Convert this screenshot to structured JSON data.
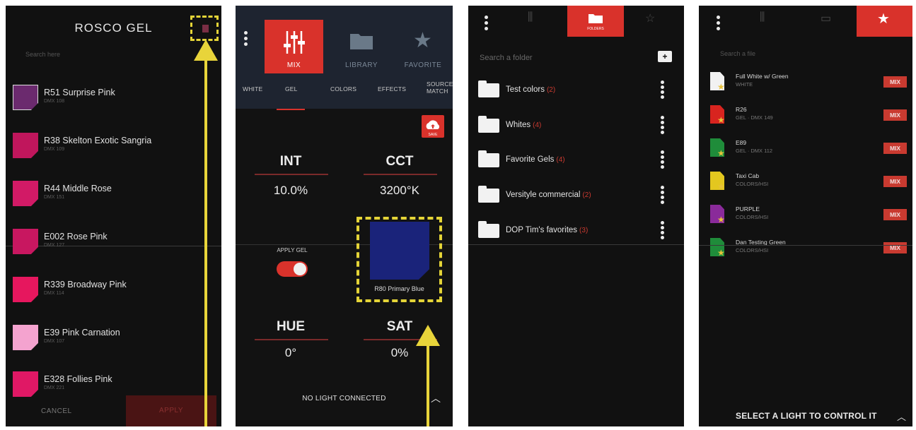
{
  "panel1": {
    "title": "ROSCO GEL",
    "search_placeholder": "Search here",
    "gels": [
      {
        "name": "R51 Surprise Pink",
        "code": "DMX 108",
        "color": "#6b2a6e"
      },
      {
        "name": "R38 Skelton Exotic Sangria",
        "code": "DMX 109",
        "color": "#c0165c"
      },
      {
        "name": "R44 Middle Rose",
        "code": "DMX 151",
        "color": "#d21a66"
      },
      {
        "name": "E002 Rose Pink",
        "code": "DMX 127",
        "color": "#c81760"
      },
      {
        "name": "R339 Broadway Pink",
        "code": "DMX 114",
        "color": "#e6175e"
      },
      {
        "name": "E39 Pink Carnation",
        "code": "DMX 107",
        "color": "#f4a3cf"
      },
      {
        "name": "E328 Follies Pink",
        "code": "DMX 221",
        "color": "#e01865"
      }
    ],
    "cancel_label": "CANCEL",
    "apply_label": "APPLY"
  },
  "panel2": {
    "tabs": [
      {
        "label": "MIX"
      },
      {
        "label": "LIBRARY"
      },
      {
        "label": "FAVORITE"
      }
    ],
    "subtabs": [
      "WHITE",
      "GEL",
      "COLORS",
      "EFFECTS",
      "SOURCE MATCH"
    ],
    "cloud_label": "SAVE",
    "int_label": "INT",
    "int_value": "10.0%",
    "cct_label": "CCT",
    "cct_value": "3200°K",
    "apply_gel_label": "APPLY GEL",
    "swatch_name": "R80 Primary Blue",
    "swatch_color": "#1a237a",
    "hue_label": "HUE",
    "hue_value": "0°",
    "sat_label": "SAT",
    "sat_value": "0%",
    "status": "NO LIGHT CONNECTED"
  },
  "panel3": {
    "active_tab": "FOLDERS",
    "search_placeholder": "Search a folder",
    "folders": [
      {
        "name": "Test colors",
        "count": "(2)"
      },
      {
        "name": "Whites",
        "count": "(4)"
      },
      {
        "name": "Favorite Gels",
        "count": "(4)"
      },
      {
        "name": "Versityle commercial",
        "count": "(2)"
      },
      {
        "name": "DOP Tim's favorites",
        "count": "(3)"
      }
    ]
  },
  "panel4": {
    "search_placeholder": "Search a file",
    "files": [
      {
        "name": "Full White w/ Green",
        "sub": "WHITE",
        "color": "#f2f2f2",
        "badge": "MIX"
      },
      {
        "name": "R26",
        "sub": "GEL · DMX 149",
        "color": "#d8241f",
        "badge": "MIX"
      },
      {
        "name": "E89",
        "sub": "GEL · DMX 112",
        "color": "#1f8c3a",
        "badge": "MIX"
      },
      {
        "name": "Taxi Cab",
        "sub": "COLORS/HSI",
        "color": "#e3c71f",
        "badge": "MIX"
      },
      {
        "name": "PURPLE",
        "sub": "COLORS/HSI",
        "color": "#8a2a9a",
        "badge": "MIX"
      },
      {
        "name": "Dan Testing Green",
        "sub": "COLORS/HSI",
        "color": "#1f8c3a",
        "badge": "MIX"
      }
    ],
    "status": "SELECT A LIGHT TO CONTROL IT"
  }
}
